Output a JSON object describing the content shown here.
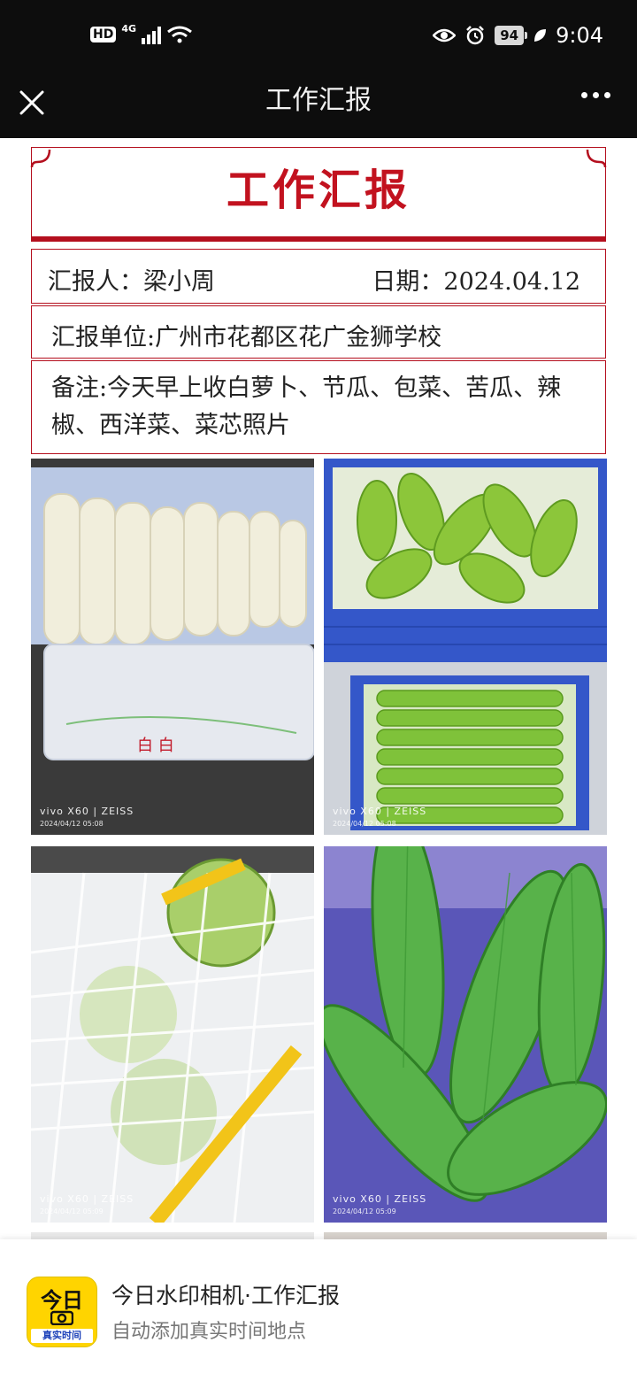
{
  "status_bar": {
    "hd": "HD",
    "network": "4G",
    "battery": "94",
    "time": "9:04"
  },
  "nav": {
    "title": "工作汇报"
  },
  "report": {
    "title": "工作汇报",
    "reporter": "汇报人：梁小周",
    "date": "日期：2024.04.12",
    "unit": "汇报单位:广州市花都区花广金狮学校",
    "note": "备注:今天早上收白萝卜、节瓜、包菜、苦瓜、辣椒、西洋菜、菜芯照片"
  },
  "photos": [
    {
      "subject": "白萝卜",
      "watermark": "vivo X60 | ZEISS",
      "stamp": "2024/04/12 05:08"
    },
    {
      "subject": "节瓜",
      "watermark": "vivo X60 | ZEISS",
      "stamp": "2024/04/12 05:08"
    },
    {
      "subject": "包菜",
      "watermark": "vivo X60 | ZEISS",
      "stamp": "2024/04/12 05:09"
    },
    {
      "subject": "苦瓜",
      "watermark": "vivo X60 | ZEISS",
      "stamp": "2024/04/12 05:09"
    }
  ],
  "banner": {
    "icon_text": "今日",
    "icon_sub": "真实时间",
    "title": "今日水印相机·工作汇报",
    "subtitle": "自动添加真实时间地点"
  },
  "colors": {
    "accent_red": "#c2121f",
    "bar_dark": "#0d0d0d",
    "brand_yellow": "#ffd400"
  }
}
